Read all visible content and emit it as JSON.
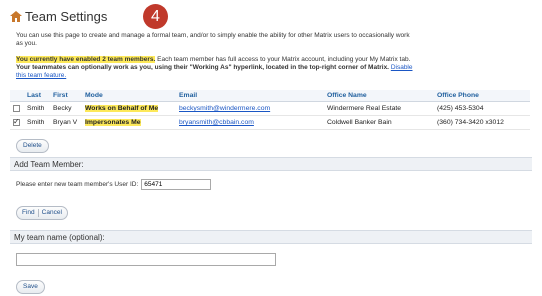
{
  "header": {
    "title": "Team Settings",
    "step_number": "4"
  },
  "intro": {
    "text": "You can use this page to create and manage a formal team, and/or to simply enable the ability for other Matrix users to occasionally work as you."
  },
  "notice": {
    "highlight": "You currently have enabled 2 team members.",
    "body": " Each team member has full access to your Matrix account, including your My Matrix tab. ",
    "bold_part": "Your teammates can optionally work as you, using their \"Working As\" hyperlink, located in the top-right corner of Matrix.",
    "link": "Disable this team feature."
  },
  "table": {
    "headers": [
      "Last",
      "First",
      "Mode",
      "Email",
      "Office Name",
      "Office Phone"
    ],
    "rows": [
      {
        "checked": false,
        "last": "Smith",
        "first": "Becky",
        "mode": "Works on Behalf of Me",
        "email": "beckysmith@windermere.com",
        "office": "Windermere Real Estate",
        "phone": "(425) 453-5304"
      },
      {
        "checked": true,
        "last": "Smith",
        "first": "Bryan V",
        "mode": "Impersonates Me",
        "email": "bryansmith@cbbain.com",
        "office": "Coldwell Banker Bain",
        "phone": "(360) 734-3420 x3012"
      }
    ]
  },
  "buttons": {
    "delete": "Delete",
    "find": "Find",
    "cancel": "Cancel",
    "save": "Save"
  },
  "add_member": {
    "heading": "Add Team Member:",
    "label": "Please enter new team member's User ID:",
    "value": "65471"
  },
  "team_name": {
    "heading": "My team name (optional):",
    "value": ""
  },
  "colors": {
    "highlight": "#fde95a",
    "link": "#1a56c4",
    "step_badge": "#c0392b",
    "header_text": "#1f5f9e"
  }
}
